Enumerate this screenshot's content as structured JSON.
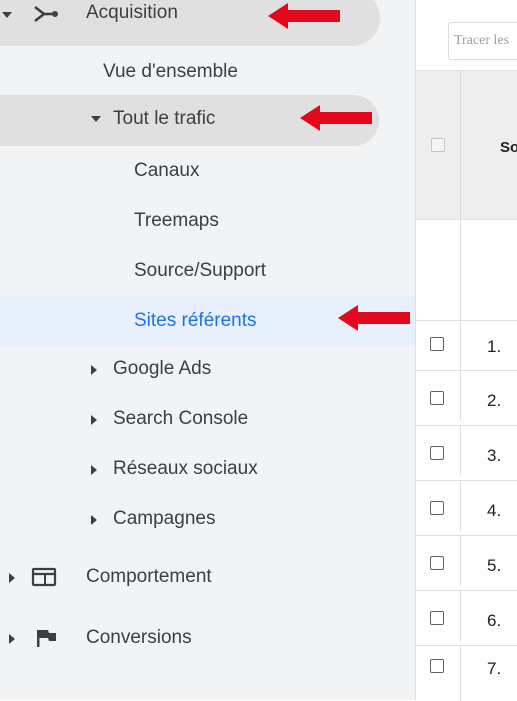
{
  "sidebar": {
    "acquisition": "Acquisition",
    "overview": "Vue d'ensemble",
    "all_traffic": "Tout le trafic",
    "channels": "Canaux",
    "treemaps": "Treemaps",
    "source_medium": "Source/Support",
    "referrals": "Sites référents",
    "google_ads": "Google Ads",
    "search_console": "Search Console",
    "social": "Réseaux sociaux",
    "campaigns": "Campagnes",
    "behavior": "Comportement",
    "conversions": "Conversions"
  },
  "table": {
    "plot_placeholder": "Tracer les",
    "header_partial": "So",
    "row_numbers": [
      "1.",
      "2.",
      "3.",
      "4.",
      "5.",
      "6.",
      "7."
    ]
  },
  "colors": {
    "selected_text": "#1a73e8",
    "annotation_arrow": "#e3081b"
  },
  "icons": {
    "acquisition": "branch-icon",
    "behavior": "layout-icon",
    "conversions": "flag-icon"
  }
}
